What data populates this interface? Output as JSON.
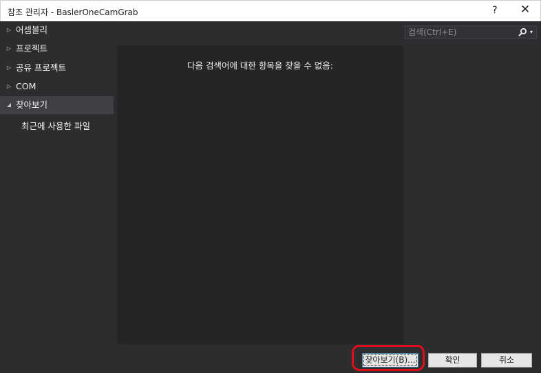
{
  "window": {
    "title": "참조 관리자 - BaslerOneCamGrab",
    "help_label": "?",
    "close_label": "✕"
  },
  "sidebar": {
    "items": [
      {
        "label": "어셈블리",
        "expanded": false
      },
      {
        "label": "프로젝트",
        "expanded": false
      },
      {
        "label": "공유 프로젝트",
        "expanded": false
      },
      {
        "label": "COM",
        "expanded": false
      },
      {
        "label": "찾아보기",
        "expanded": true,
        "selected": true
      }
    ],
    "subitems": [
      {
        "label": "최근에 사용한 파일"
      }
    ]
  },
  "main": {
    "empty_message": "다음 검색어에 대한 항목을 찾을 수 없음:"
  },
  "search": {
    "placeholder": "검색(Ctrl+E)",
    "value": ""
  },
  "buttons": {
    "browse": "찾아보기(B)...",
    "ok": "확인",
    "cancel": "취소"
  },
  "icons": {
    "collapsed_arrow": "▷",
    "expanded_arrow": "◢",
    "search": "search-icon",
    "dropdown": "▾"
  },
  "colors": {
    "background": "#2d2d30",
    "panel": "#252526",
    "selected": "#3f3f46",
    "highlight_annotation": "#e0101a"
  }
}
